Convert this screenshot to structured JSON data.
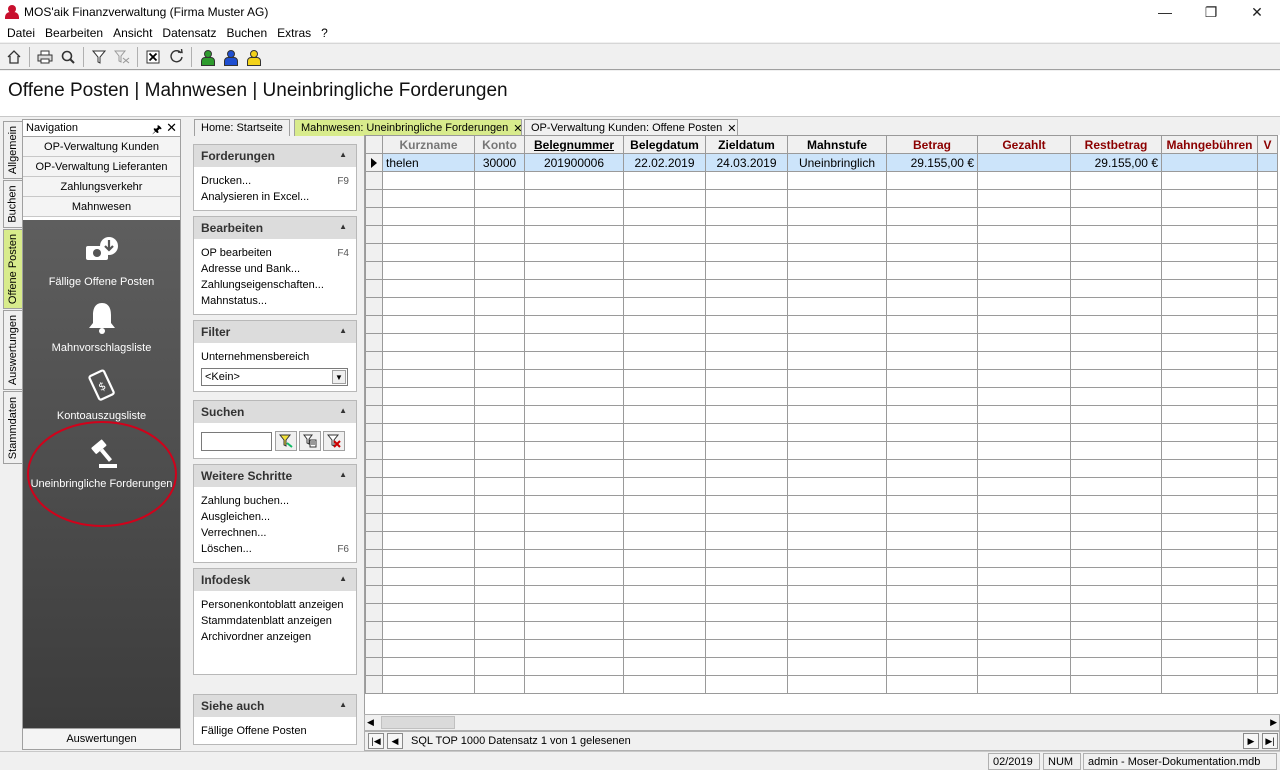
{
  "window": {
    "title": "MOS'aik Finanzverwaltung (Firma Muster AG)",
    "controls": [
      "—",
      "❐",
      "✕"
    ]
  },
  "menu": [
    "Datei",
    "Bearbeiten",
    "Ansicht",
    "Datensatz",
    "Buchen",
    "Extras",
    "?"
  ],
  "toolbar": {
    "icons": [
      "home-icon",
      "print-icon",
      "print-preview-icon",
      "filter-icon",
      "filter-clear-icon",
      "delete-icon",
      "refresh-icon",
      "user-green-icon",
      "user-blue-icon",
      "user-yellow-icon"
    ],
    "person_colors": [
      "#2e9b2e",
      "#1f4fd1",
      "#f2d21a"
    ]
  },
  "page_title": "Offene Posten | Mahnwesen | Uneinbringliche Forderungen",
  "vertical_tabs": [
    {
      "label": "Allgemein",
      "active": false
    },
    {
      "label": "Buchen",
      "active": false
    },
    {
      "label": "Offene Posten",
      "active": true
    },
    {
      "label": "Auswertungen",
      "active": false
    },
    {
      "label": "Stammdaten",
      "active": false
    }
  ],
  "navigation": {
    "header": "Navigation",
    "buttons": [
      "OP-Verwaltung Kunden",
      "OP-Verwaltung Lieferanten",
      "Zahlungsverkehr",
      "Mahnwesen"
    ],
    "tiles": [
      "Fällige Offene Posten",
      "Mahnvorschlagsliste",
      "Kontoauszugsliste",
      "Uneinbringliche Forderungen"
    ],
    "bottom": "Auswertungen"
  },
  "taskpane": {
    "forderungen": {
      "title": "Forderungen",
      "items": [
        {
          "label": "Drucken...",
          "key": "F9"
        },
        {
          "label": "Analysieren in Excel...",
          "key": ""
        }
      ]
    },
    "bearbeiten": {
      "title": "Bearbeiten",
      "items": [
        {
          "label": "OP bearbeiten",
          "key": "F4"
        },
        {
          "label": "Adresse und Bank...",
          "key": ""
        },
        {
          "label": "Zahlungseigenschaften...",
          "key": ""
        },
        {
          "label": "Mahnstatus...",
          "key": ""
        }
      ]
    },
    "filter": {
      "title": "Filter",
      "label": "Unternehmensbereich",
      "value": "<Kein>"
    },
    "suchen": {
      "title": "Suchen",
      "value": ""
    },
    "weitere": {
      "title": "Weitere Schritte",
      "items": [
        {
          "label": "Zahlung buchen...",
          "key": ""
        },
        {
          "label": "Ausgleichen...",
          "key": ""
        },
        {
          "label": "Verrechnen...",
          "key": ""
        },
        {
          "label": "Löschen...",
          "key": "F6"
        }
      ]
    },
    "infodesk": {
      "title": "Infodesk",
      "items": [
        {
          "label": "Personenkontoblatt anzeigen",
          "key": ""
        },
        {
          "label": "Stammdatenblatt anzeigen",
          "key": ""
        },
        {
          "label": "Archivordner anzeigen",
          "key": ""
        }
      ]
    },
    "siehe": {
      "title": "Siehe auch",
      "items": [
        {
          "label": "Fällige Offene Posten",
          "key": ""
        }
      ]
    }
  },
  "doc_tabs": [
    {
      "label": "Home: Startseite",
      "active": false,
      "closable": false
    },
    {
      "label": "Mahnwesen: Uneinbringliche Forderungen",
      "active": true,
      "closable": true
    },
    {
      "label": "OP-Verwaltung Kunden: Offene Posten",
      "active": false,
      "closable": true
    }
  ],
  "grid": {
    "columns": [
      {
        "label": "Kurzname",
        "style": "gray"
      },
      {
        "label": "Konto",
        "style": "gray"
      },
      {
        "label": "Belegnummer",
        "style": "underline"
      },
      {
        "label": "Belegdatum",
        "style": ""
      },
      {
        "label": "Zieldatum",
        "style": ""
      },
      {
        "label": "Mahnstufe",
        "style": ""
      },
      {
        "label": "Betrag",
        "style": "red"
      },
      {
        "label": "Gezahlt",
        "style": "red"
      },
      {
        "label": "Restbetrag",
        "style": "red"
      },
      {
        "label": "Mahngebühren",
        "style": "red"
      },
      {
        "label": "V",
        "style": "red"
      }
    ],
    "rows": [
      [
        "thelen",
        "30000",
        "201900006",
        "22.02.2019",
        "24.03.2019",
        "Uneinbringlich",
        "29.155,00 €",
        "",
        "29.155,00 €",
        "",
        ""
      ]
    ]
  },
  "record_nav": {
    "text": "SQL TOP 1000 Datensatz 1 von 1 gelesenen"
  },
  "statusbar": {
    "period": "02/2019",
    "num": "NUM",
    "db": "admin - Moser-Dokumentation.mdb"
  }
}
